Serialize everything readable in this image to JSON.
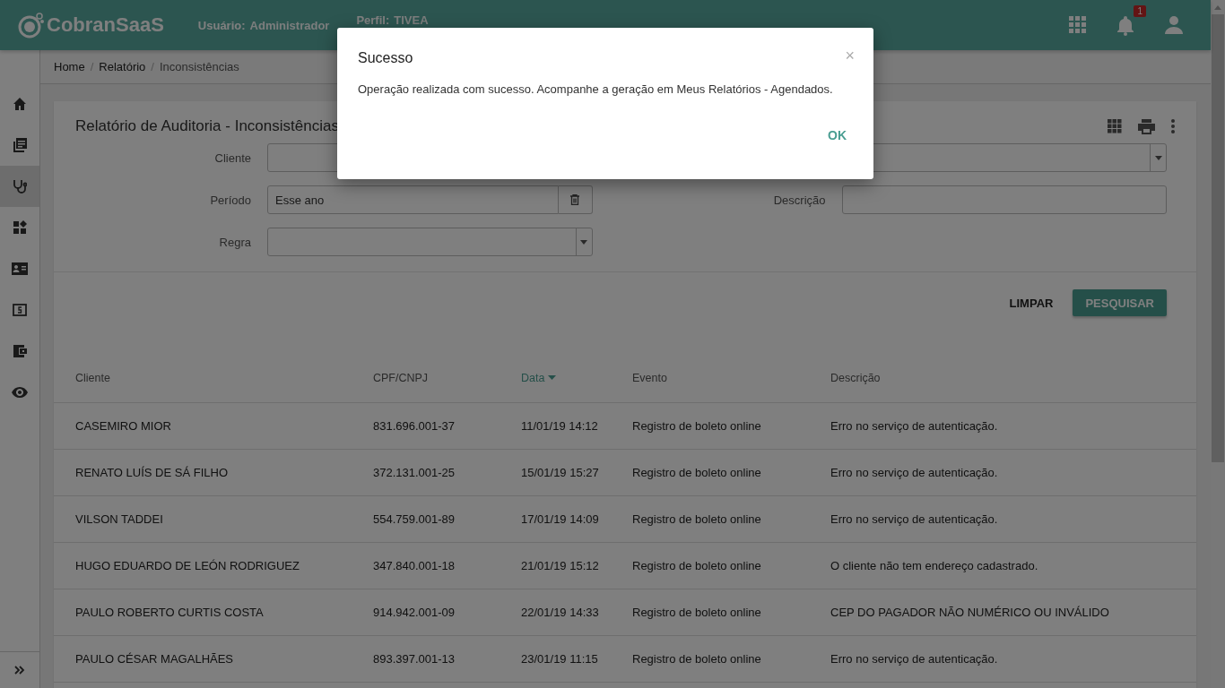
{
  "header": {
    "logo": "CobranSaaS",
    "user_label": "Usuário:",
    "user_value": "Administrador",
    "profile_label": "Perfil:",
    "profile_value": "TIVEA",
    "notification_count": "1"
  },
  "sidebar": {
    "items": [
      {
        "kind": "home",
        "selected": false
      },
      {
        "kind": "library",
        "selected": false
      },
      {
        "kind": "stethoscope",
        "selected": true
      },
      {
        "kind": "widgets",
        "selected": false
      },
      {
        "kind": "contact",
        "selected": false
      },
      {
        "kind": "money",
        "selected": false
      },
      {
        "kind": "wallet",
        "selected": false
      },
      {
        "kind": "eye",
        "selected": false
      }
    ]
  },
  "breadcrumb": {
    "separator": "/",
    "items": [
      "Home",
      "Relatório",
      "Inconsistências"
    ]
  },
  "report": {
    "title": "Relatório de Auditoria - Inconsistências",
    "filters_left": [
      {
        "label": "Cliente",
        "kind": "text"
      },
      {
        "label": "Período",
        "kind": "clearable",
        "value": "Esse ano"
      },
      {
        "label": "Regra",
        "kind": "select"
      }
    ],
    "filters_right": [
      {
        "kind": "select"
      },
      {
        "label": "Descrição",
        "kind": "text"
      }
    ],
    "clear_button": "LIMPAR",
    "search_button": "PESQUISAR"
  },
  "table": {
    "columns": [
      {
        "label": "Cliente",
        "sorted": false
      },
      {
        "label": "CPF/CNPJ",
        "sorted": false
      },
      {
        "label": "Data",
        "sorted": true
      },
      {
        "label": "Evento",
        "sorted": false
      },
      {
        "label": "Descrição",
        "sorted": false
      }
    ],
    "rows": [
      [
        "CASEMIRO MIOR",
        "831.696.001-37",
        "11/01/19 14:12",
        "Registro de boleto online",
        "Erro no serviço de autenticação."
      ],
      [
        "RENATO LUÍS DE SÁ FILHO",
        "372.131.001-25",
        "15/01/19 15:27",
        "Registro de boleto online",
        "Erro no serviço de autenticação."
      ],
      [
        "VILSON TADDEI",
        "554.759.001-89",
        "17/01/19 14:09",
        "Registro de boleto online",
        "Erro no serviço de autenticação."
      ],
      [
        "HUGO EDUARDO DE LEÓN RODRIGUEZ",
        "347.840.001-18",
        "21/01/19 15:12",
        "Registro de boleto online",
        "O cliente não tem endereço cadastrado."
      ],
      [
        "PAULO ROBERTO CURTIS COSTA",
        "914.942.001-09",
        "22/01/19 14:33",
        "Registro de boleto online",
        "CEP DO PAGADOR NÃO NUMÉRICO OU INVÁLIDO"
      ],
      [
        "PAULO CÉSAR MAGALHÃES",
        "893.397.001-13",
        "23/01/19 11:15",
        "Registro de boleto online",
        "Erro no serviço de autenticação."
      ]
    ]
  },
  "modal": {
    "title": "Sucesso",
    "close": "×",
    "message": "Operação realizada com sucesso. Acompanhe a geração em Meus Relatórios - Agendados.",
    "button": "OK"
  }
}
